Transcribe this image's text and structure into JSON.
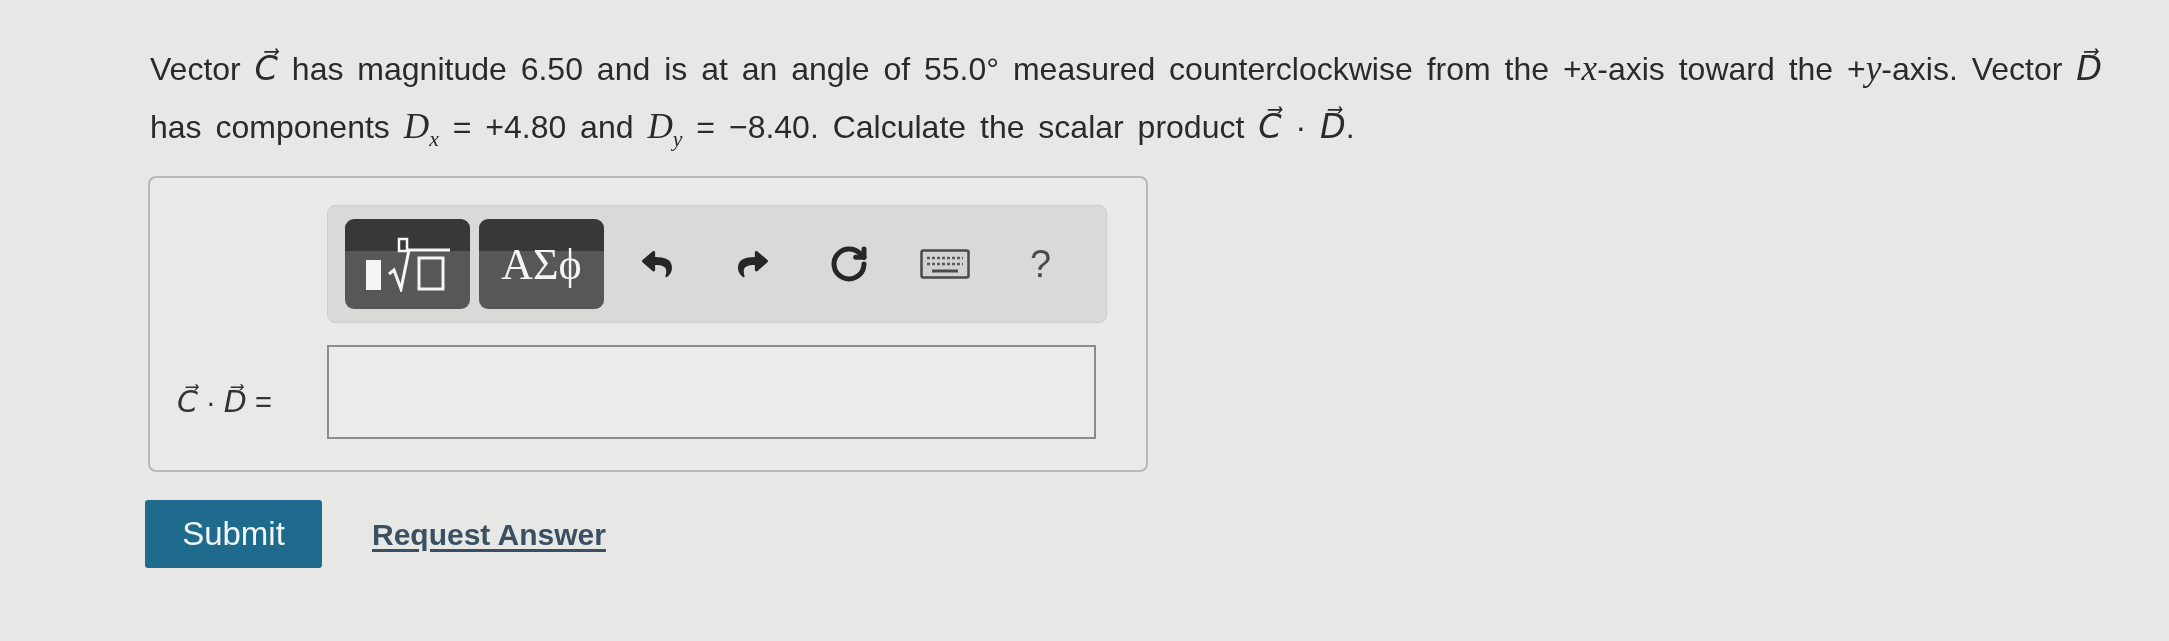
{
  "question": {
    "text": "Vector *C⃗* has magnitude 6.50 and is at an angle of 55.0° measured counterclockwise from the +*x*-axis toward the +*y*-axis. Vector *D⃗* has components *D*$_{x}$ = +4.80 and *D*$_{y}$ = −8.40. Calculate the scalar product *C⃗* · *D⃗*."
  },
  "answer": {
    "toolbar": [
      {
        "kind": "template"
      },
      {
        "kind": "symbols",
        "label": "ΑΣϕ"
      },
      {
        "kind": "undo"
      },
      {
        "kind": "redo"
      },
      {
        "kind": "reset"
      },
      {
        "kind": "keyboard"
      },
      {
        "kind": "help",
        "label": "?"
      }
    ],
    "label": "*C⃗* · *D⃗* ="
  },
  "actions": {
    "submit": "Submit",
    "request_answer": "Request Answer"
  }
}
